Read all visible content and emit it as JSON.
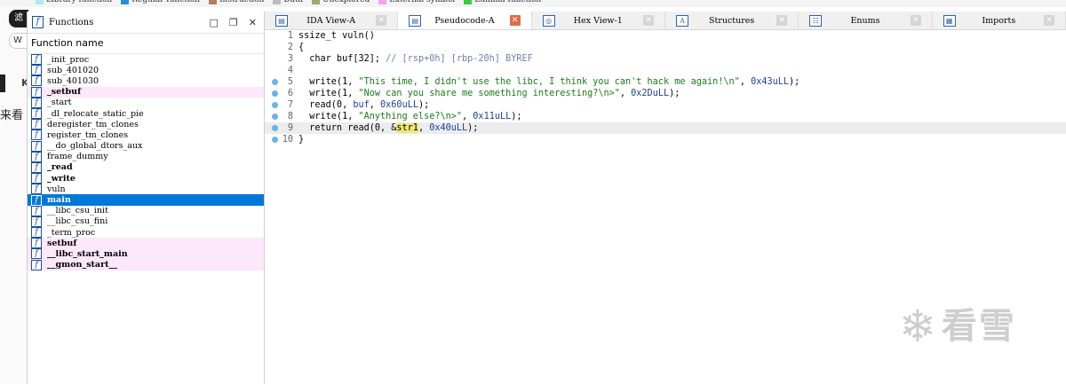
{
  "legend": [
    {
      "label": "Library function",
      "color": "#aee8f0"
    },
    {
      "label": "Regular function",
      "color": "#2c8fd4"
    },
    {
      "label": "Instruction",
      "color": "#b57d5c"
    },
    {
      "label": "Data",
      "color": "#bdbdbd"
    },
    {
      "label": "Unexplored",
      "color": "#a8a374"
    },
    {
      "label": "External symbol",
      "color": "#f2a2ec"
    },
    {
      "label": "Lumina function",
      "color": "#3ec93e"
    }
  ],
  "background": {
    "pill_text": "滤",
    "w_text": "W",
    "k_text": "K",
    "side_text": "来看"
  },
  "functions_window": {
    "title": "Functions",
    "icon": "f",
    "controls": [
      "□",
      "❐",
      "✕"
    ],
    "column_header": "Function name",
    "items": [
      {
        "name": "_init_proc",
        "kind": "regular"
      },
      {
        "name": "sub_401020",
        "kind": "regular"
      },
      {
        "name": "sub_401030",
        "kind": "regular"
      },
      {
        "name": "_setbuf",
        "kind": "import"
      },
      {
        "name": "_start",
        "kind": "regular"
      },
      {
        "name": "_dl_relocate_static_pie",
        "kind": "regular"
      },
      {
        "name": "deregister_tm_clones",
        "kind": "regular"
      },
      {
        "name": "register_tm_clones",
        "kind": "regular"
      },
      {
        "name": "__do_global_dtors_aux",
        "kind": "regular"
      },
      {
        "name": "frame_dummy",
        "kind": "regular"
      },
      {
        "name": "_read",
        "kind": "bold"
      },
      {
        "name": "_write",
        "kind": "bold"
      },
      {
        "name": "vuln",
        "kind": "regular"
      },
      {
        "name": "main",
        "kind": "selected"
      },
      {
        "name": "__libc_csu_init",
        "kind": "regular"
      },
      {
        "name": "__libc_csu_fini",
        "kind": "regular"
      },
      {
        "name": "_term_proc",
        "kind": "regular"
      },
      {
        "name": "setbuf",
        "kind": "import"
      },
      {
        "name": "__libc_start_main",
        "kind": "import"
      },
      {
        "name": "__gmon_start__",
        "kind": "import"
      }
    ]
  },
  "tabs": [
    {
      "label": "IDA View-A",
      "icon": "▤",
      "active": false
    },
    {
      "label": "Pseudocode-A",
      "icon": "▤",
      "active": true
    },
    {
      "label": "Hex View-1",
      "icon": "◎",
      "active": false
    },
    {
      "label": "Structures",
      "icon": "A",
      "active": false
    },
    {
      "label": "Enums",
      "icon": "☷",
      "active": false
    },
    {
      "label": "Imports",
      "icon": "▦",
      "active": false
    }
  ],
  "code": [
    {
      "n": "1",
      "dot": false,
      "hl": false,
      "parts": [
        [
          "t",
          "ssize_t vuln()"
        ]
      ]
    },
    {
      "n": "2",
      "dot": false,
      "hl": false,
      "parts": [
        [
          "t",
          "{"
        ]
      ]
    },
    {
      "n": "3",
      "dot": false,
      "hl": false,
      "parts": [
        [
          "t",
          "  char buf[32]; "
        ],
        [
          "c",
          "// [rsp+0h] [rbp-20h] BYREF"
        ]
      ]
    },
    {
      "n": "4",
      "dot": false,
      "hl": false,
      "parts": []
    },
    {
      "n": "5",
      "dot": true,
      "hl": false,
      "parts": [
        [
          "t",
          "  write(1, "
        ],
        [
          "s",
          "\"This time, I didn't use the libc, I think you can't hack me again!\\n\""
        ],
        [
          "t",
          ", "
        ],
        [
          "n",
          "0x43uLL"
        ],
        [
          "t",
          ");"
        ]
      ]
    },
    {
      "n": "6",
      "dot": true,
      "hl": false,
      "parts": [
        [
          "t",
          "  write(1, "
        ],
        [
          "s",
          "\"Now can you share me something interesting?\\n>\""
        ],
        [
          "t",
          ", "
        ],
        [
          "n",
          "0x2DuLL"
        ],
        [
          "t",
          ");"
        ]
      ]
    },
    {
      "n": "7",
      "dot": true,
      "hl": false,
      "parts": [
        [
          "t",
          "  read(0, "
        ],
        [
          "k",
          "buf"
        ],
        [
          "t",
          ", "
        ],
        [
          "n",
          "0x60uLL"
        ],
        [
          "t",
          ");"
        ]
      ]
    },
    {
      "n": "8",
      "dot": true,
      "hl": false,
      "parts": [
        [
          "t",
          "  write(1, "
        ],
        [
          "s",
          "\"Anything else?\\n>\""
        ],
        [
          "t",
          ", "
        ],
        [
          "n",
          "0x11uLL"
        ],
        [
          "t",
          ");"
        ]
      ]
    },
    {
      "n": "9",
      "dot": true,
      "hl": true,
      "parts": [
        [
          "t",
          "  return read(0, &"
        ],
        [
          "g",
          "str1"
        ],
        [
          "t",
          ", "
        ],
        [
          "n",
          "0x40uLL"
        ],
        [
          "t",
          ");"
        ]
      ]
    },
    {
      "n": "10",
      "dot": true,
      "hl": false,
      "parts": [
        [
          "t",
          "}"
        ]
      ]
    }
  ],
  "watermark": {
    "icon": "❄",
    "text": "看雪"
  }
}
